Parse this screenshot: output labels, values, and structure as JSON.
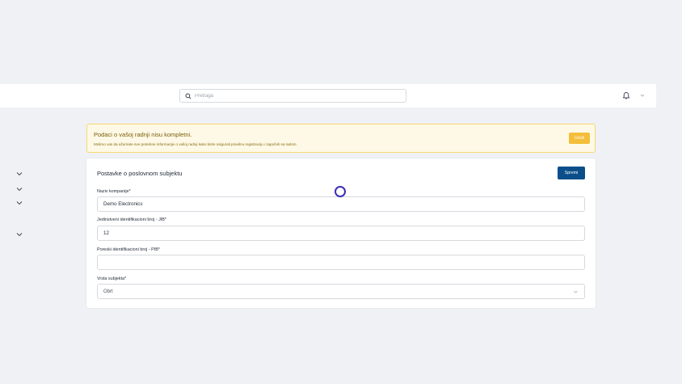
{
  "header": {
    "search_placeholder": "Pretraga",
    "notification_icon": "bell-icon",
    "user_menu_icon": "chevron-down-icon"
  },
  "sidebar": {
    "collapsed_groups": [
      {
        "icon": "chevron-down-icon"
      },
      {
        "icon": "chevron-down-icon"
      },
      {
        "icon": "chevron-down-icon"
      },
      {
        "icon": "chevron-down-icon"
      }
    ]
  },
  "alert": {
    "title": "Podaci o vašoj radnji nisu kompletni.",
    "message": "Molimo vas da ažurirate sve potrebne informacije o vašoj radnji kako biste osigurali pravilnu registraciju i započeli sa radom.",
    "button_label": "Uredi",
    "bg_color": "#fef9e6",
    "accent_color": "#f4be3a"
  },
  "settings": {
    "title": "Postavke o poslovnom subjektu",
    "save_label": "Spremi",
    "save_color": "#0b4f8a",
    "fields": {
      "company_name": {
        "label": "Naziv kompanije*",
        "value": "Demo Electronics"
      },
      "jib": {
        "label": "Jedinstveni identifikacioni broj - JIB*",
        "value": "12"
      },
      "pib": {
        "label": "Poreski identifikacioni broj - PIB*",
        "value": ""
      },
      "entity_type": {
        "label": "Vrsta subjekta*",
        "value": "Obrt"
      }
    }
  }
}
